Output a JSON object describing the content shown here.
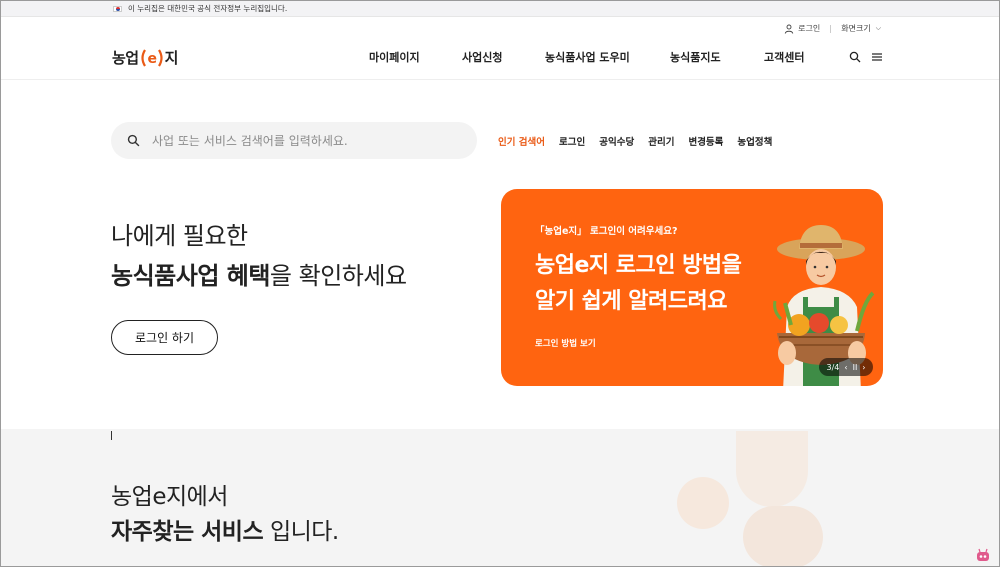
{
  "gov_banner": {
    "text": "이 누리집은 대한민국 공식 전자정부 누리집입니다."
  },
  "util": {
    "login": "로그인",
    "zoom": "화면크기"
  },
  "logo": {
    "prefix": "농업",
    "e": "e",
    "suffix": "지"
  },
  "nav": {
    "items": [
      "마이페이지",
      "사업신청",
      "농식품사업 도우미",
      "농식품지도",
      "고객센터"
    ]
  },
  "search": {
    "placeholder": "사업 또는 서비스 검색어를 입력하세요."
  },
  "keywords": {
    "label": "인기 검색어",
    "items": [
      "로그인",
      "공익수당",
      "관리기",
      "변경등록",
      "농업정책"
    ]
  },
  "hero": {
    "line1": "나에게 필요한",
    "line2_bold": "농식품사업 혜택",
    "line2_rest": "을 확인하세요",
    "login_button": "로그인 하기"
  },
  "banner": {
    "sub": "「농업e지」 로그인이 어려우세요?",
    "title1": "농업e지 로그인 방법을",
    "title2": "알기 쉽게 알려드려요",
    "more": "로그인 방법 보기",
    "pager": "3/4",
    "prev": "‹",
    "pause": "II",
    "next": "›"
  },
  "lower": {
    "line1": "농업e지에서",
    "line2_bold": "자주찾는 서비스",
    "line2_rest": " 입니다."
  },
  "colors": {
    "accent": "#ff6410",
    "accent_text": "#ea5a16"
  }
}
